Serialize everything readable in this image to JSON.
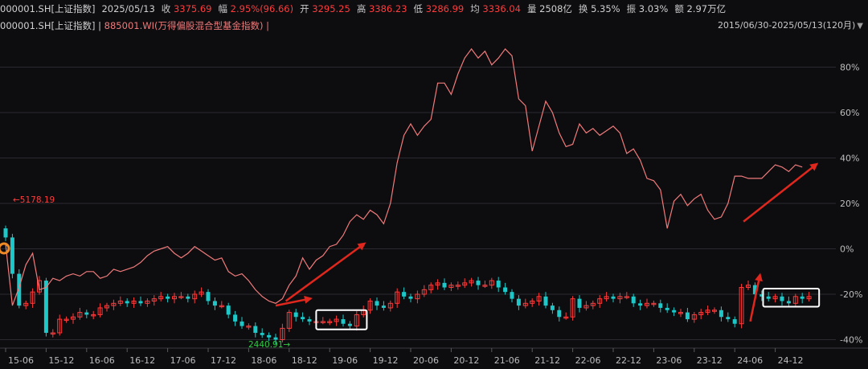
{
  "header": {
    "code": "000001.SH[上证指数]",
    "date": "2025/05/13",
    "close_label": "收",
    "close_val": "3375.69",
    "chg_label": "幅",
    "chg_val": "2.95%(96.66)",
    "open_label": "开",
    "open_val": "3295.25",
    "high_label": "高",
    "high_val": "3386.23",
    "low_label": "低",
    "low_val": "3286.99",
    "avg_label": "均",
    "avg_val": "3336.04",
    "vol_label": "量",
    "vol_val": "2508亿",
    "turn_label": "换",
    "turn_val": "5.35%",
    "amp_label": "振",
    "amp_val": "3.03%",
    "amt_label": "额",
    "amt_val": "2.97万亿"
  },
  "legend": {
    "series1": "000001.SH[上证指数] |",
    "series2": "885001.WI(万得偏股混合型基金指数) |",
    "range": "2015/06/30-2025/05/13(120月)",
    "range_icon": "triangle-down-icon"
  },
  "colors": {
    "up": "#ff3b3b",
    "down": "#1fc8c8",
    "fund_line": "#f07a7a",
    "low_label": "#2ecc40",
    "arrow": "#e0271d",
    "box": "#ffffff",
    "grid": "#2a2a30"
  },
  "chart_data": {
    "type": "line",
    "title": "",
    "xlabel": "",
    "ylabel": "",
    "y_axis": "right",
    "ylim": [
      -0.44,
      0.92
    ],
    "y_ticks": [
      "80%",
      "60%",
      "40%",
      "20%",
      "0%",
      "-20%",
      "-40%"
    ],
    "y_tick_values": [
      0.8,
      0.6,
      0.4,
      0.2,
      0.0,
      -0.2,
      -0.4
    ],
    "x_ticks": [
      "15-06",
      "15-12",
      "16-06",
      "16-12",
      "17-06",
      "17-12",
      "18-06",
      "18-12",
      "19-06",
      "19-12",
      "20-06",
      "20-12",
      "21-06",
      "21-12",
      "22-06",
      "22-12",
      "23-06",
      "23-12",
      "24-06",
      "24-12"
    ],
    "x_tick_months": [
      0,
      6,
      12,
      18,
      24,
      30,
      36,
      42,
      48,
      54,
      60,
      66,
      72,
      78,
      84,
      90,
      96,
      102,
      108,
      114
    ],
    "annotations": {
      "high": "5178.19",
      "low": "2440.91"
    },
    "series": [
      {
        "name": "885001.WI(万得偏股混合型基金指数)",
        "kind": "line",
        "months": [
          0,
          1,
          2,
          3,
          4,
          5,
          6,
          7,
          8,
          9,
          10,
          11,
          12,
          13,
          14,
          15,
          16,
          17,
          18,
          19,
          20,
          21,
          22,
          23,
          24,
          25,
          26,
          27,
          28,
          29,
          30,
          31,
          32,
          33,
          34,
          35,
          36,
          37,
          38,
          39,
          40,
          41,
          42,
          43,
          44,
          45,
          46,
          47,
          48,
          49,
          50,
          51,
          52,
          53,
          54,
          55,
          56,
          57,
          58,
          59,
          60,
          61,
          62,
          63,
          64,
          65,
          66,
          67,
          68,
          69,
          70,
          71,
          72,
          73,
          74,
          75,
          76,
          77,
          78,
          79,
          80,
          81,
          82,
          83,
          84,
          85,
          86,
          87,
          88,
          89,
          90,
          91,
          92,
          93,
          94,
          95,
          96,
          97,
          98,
          99,
          100,
          101,
          102,
          103,
          104,
          105,
          106,
          107,
          108,
          109,
          110,
          111,
          112,
          113,
          114,
          115,
          116,
          117,
          118
        ],
        "values": [
          0.02,
          -0.25,
          -0.17,
          -0.07,
          -0.02,
          -0.18,
          -0.17,
          -0.13,
          -0.14,
          -0.12,
          -0.11,
          -0.12,
          -0.1,
          -0.1,
          -0.13,
          -0.12,
          -0.09,
          -0.1,
          -0.09,
          -0.08,
          -0.06,
          -0.03,
          -0.01,
          0.0,
          0.01,
          -0.02,
          -0.04,
          -0.02,
          0.01,
          -0.01,
          -0.03,
          -0.05,
          -0.04,
          -0.1,
          -0.12,
          -0.11,
          -0.14,
          -0.18,
          -0.21,
          -0.23,
          -0.24,
          -0.22,
          -0.16,
          -0.12,
          -0.04,
          -0.09,
          -0.05,
          -0.03,
          0.01,
          0.02,
          0.06,
          0.12,
          0.15,
          0.13,
          0.17,
          0.15,
          0.11,
          0.2,
          0.38,
          0.5,
          0.55,
          0.5,
          0.54,
          0.57,
          0.73,
          0.73,
          0.68,
          0.77,
          0.84,
          0.88,
          0.84,
          0.87,
          0.81,
          0.84,
          0.88,
          0.85,
          0.66,
          0.63,
          0.43,
          0.54,
          0.65,
          0.6,
          0.51,
          0.45,
          0.46,
          0.55,
          0.51,
          0.53,
          0.5,
          0.52,
          0.54,
          0.51,
          0.42,
          0.44,
          0.39,
          0.31,
          0.3,
          0.26,
          0.09,
          0.21,
          0.24,
          0.19,
          0.22,
          0.24,
          0.17,
          0.13,
          0.14,
          0.2,
          0.32,
          0.32,
          0.31,
          0.31,
          0.31,
          0.34,
          0.37,
          0.36,
          0.34,
          0.37,
          0.36
        ]
      },
      {
        "name": "000001.SH[上证指数]",
        "kind": "candlestick",
        "months": [
          0,
          1,
          2,
          3,
          4,
          5,
          6,
          7,
          8,
          9,
          10,
          11,
          12,
          13,
          14,
          15,
          16,
          17,
          18,
          19,
          20,
          21,
          22,
          23,
          24,
          25,
          26,
          27,
          28,
          29,
          30,
          31,
          32,
          33,
          34,
          35,
          36,
          37,
          38,
          39,
          40,
          41,
          42,
          43,
          44,
          45,
          46,
          47,
          48,
          49,
          50,
          51,
          52,
          53,
          54,
          55,
          56,
          57,
          58,
          59,
          60,
          61,
          62,
          63,
          64,
          65,
          66,
          67,
          68,
          69,
          70,
          71,
          72,
          73,
          74,
          75,
          76,
          77,
          78,
          79,
          80,
          81,
          82,
          83,
          84,
          85,
          86,
          87,
          88,
          89,
          90,
          91,
          92,
          93,
          94,
          95,
          96,
          97,
          98,
          99,
          100,
          101,
          102,
          103,
          104,
          105,
          106,
          107,
          108,
          109,
          110,
          111,
          112,
          113,
          114,
          115,
          116,
          117,
          118,
          119
        ],
        "values": [
          0.05,
          -0.11,
          -0.25,
          -0.24,
          -0.19,
          -0.14,
          -0.37,
          -0.37,
          -0.31,
          -0.31,
          -0.3,
          -0.28,
          -0.29,
          -0.29,
          -0.26,
          -0.25,
          -0.24,
          -0.23,
          -0.24,
          -0.23,
          -0.24,
          -0.23,
          -0.22,
          -0.21,
          -0.22,
          -0.21,
          -0.21,
          -0.22,
          -0.2,
          -0.19,
          -0.23,
          -0.25,
          -0.25,
          -0.29,
          -0.32,
          -0.34,
          -0.34,
          -0.37,
          -0.38,
          -0.39,
          -0.4,
          -0.35,
          -0.28,
          -0.3,
          -0.31,
          -0.32,
          -0.32,
          -0.32,
          -0.32,
          -0.31,
          -0.33,
          -0.34,
          -0.29,
          -0.27,
          -0.23,
          -0.25,
          -0.26,
          -0.24,
          -0.19,
          -0.21,
          -0.22,
          -0.2,
          -0.18,
          -0.16,
          -0.15,
          -0.17,
          -0.16,
          -0.16,
          -0.15,
          -0.14,
          -0.16,
          -0.16,
          -0.14,
          -0.17,
          -0.19,
          -0.22,
          -0.25,
          -0.24,
          -0.23,
          -0.21,
          -0.25,
          -0.27,
          -0.3,
          -0.3,
          -0.22,
          -0.26,
          -0.25,
          -0.24,
          -0.22,
          -0.21,
          -0.22,
          -0.21,
          -0.21,
          -0.24,
          -0.25,
          -0.24,
          -0.24,
          -0.26,
          -0.27,
          -0.28,
          -0.28,
          -0.31,
          -0.29,
          -0.28,
          -0.27,
          -0.27,
          -0.3,
          -0.31,
          -0.33,
          -0.17,
          -0.16,
          -0.2,
          -0.21,
          -0.22,
          -0.21,
          -0.23,
          -0.24,
          -0.21,
          -0.22,
          -0.21
        ]
      }
    ]
  }
}
